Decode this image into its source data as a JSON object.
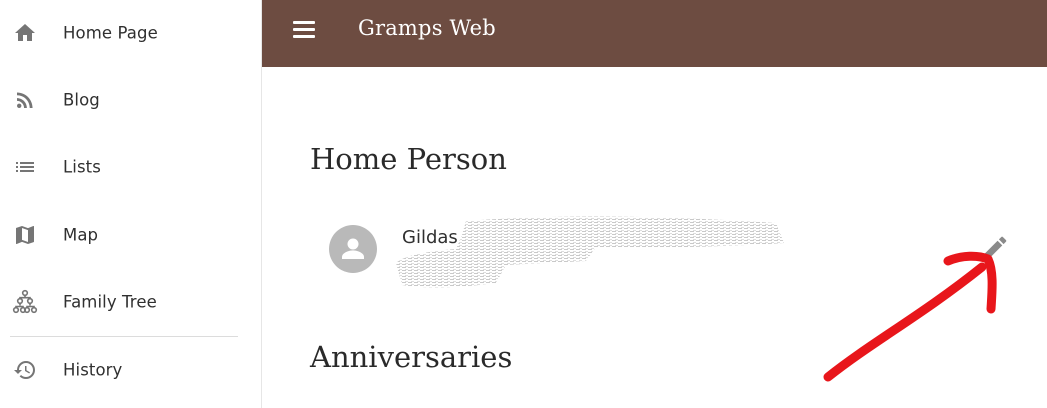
{
  "app": {
    "title": "Gramps Web"
  },
  "sidebar": {
    "items": [
      {
        "label": "Home Page",
        "icon": "home-icon"
      },
      {
        "label": "Blog",
        "icon": "rss-icon"
      },
      {
        "label": "Lists",
        "icon": "list-icon"
      },
      {
        "label": "Map",
        "icon": "map-icon"
      },
      {
        "label": "Family Tree",
        "icon": "family-tree-icon"
      },
      {
        "label": "History",
        "icon": "history-icon"
      }
    ]
  },
  "home_person": {
    "heading": "Home Person",
    "name": "Gildas",
    "avatar_icon": "person-icon",
    "edit_icon": "pencil-icon"
  },
  "anniversaries": {
    "heading": "Anniversaries"
  },
  "colors": {
    "appbar": "#6d4c41",
    "icon_gray": "#757575",
    "annotation_red": "#e8161b"
  }
}
